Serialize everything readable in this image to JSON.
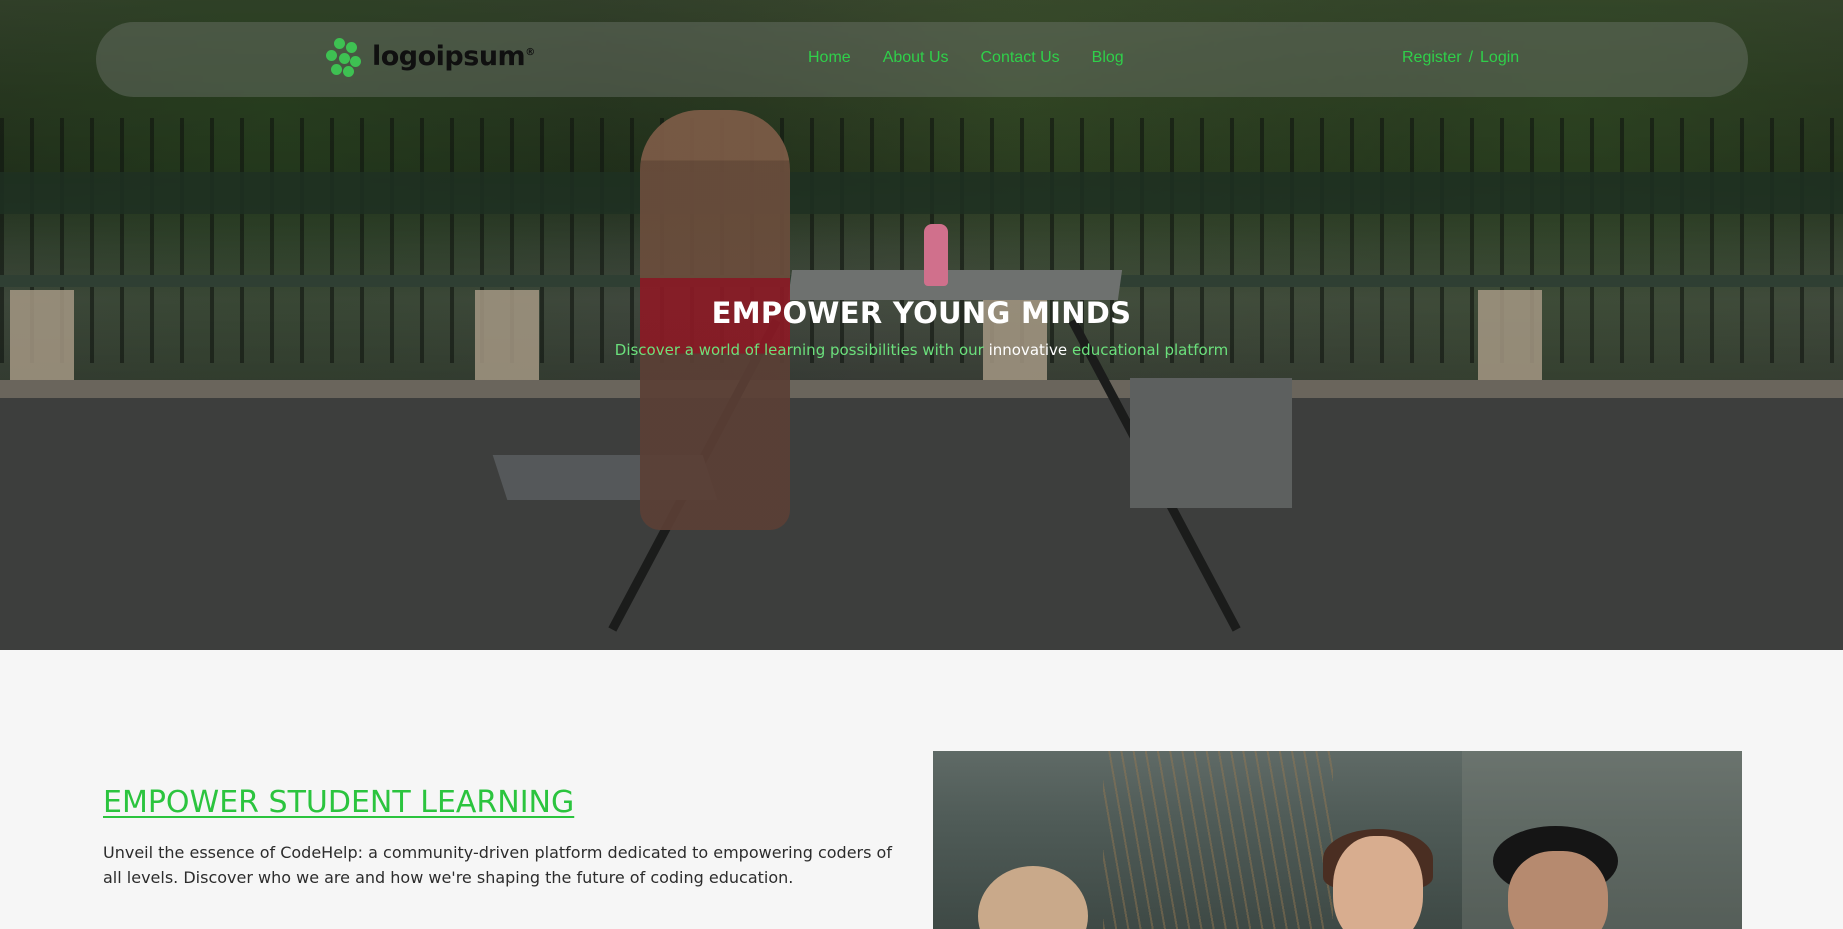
{
  "brand": {
    "name": "logoipsum",
    "mark_symbol": "®"
  },
  "nav": {
    "links": [
      "Home",
      "About Us",
      "Contact Us",
      "Blog"
    ],
    "register": "Register",
    "separator": "/",
    "login": "Login"
  },
  "hero": {
    "title": "EMPOWER YOUNG MINDS",
    "subtitle_before": "Discover a world of learning possibilities with our ",
    "subtitle_highlight": "innovative",
    "subtitle_after": " educational platform"
  },
  "section": {
    "title": "EMPOWER STUDENT LEARNING",
    "text": "Unveil the essence of CodeHelp: a community-driven platform dedicated to empowering coders of all levels. Discover who we are and how we're shaping the future of coding education."
  },
  "colors": {
    "accent": "#2fd04a",
    "background": "#f6f6f6"
  }
}
